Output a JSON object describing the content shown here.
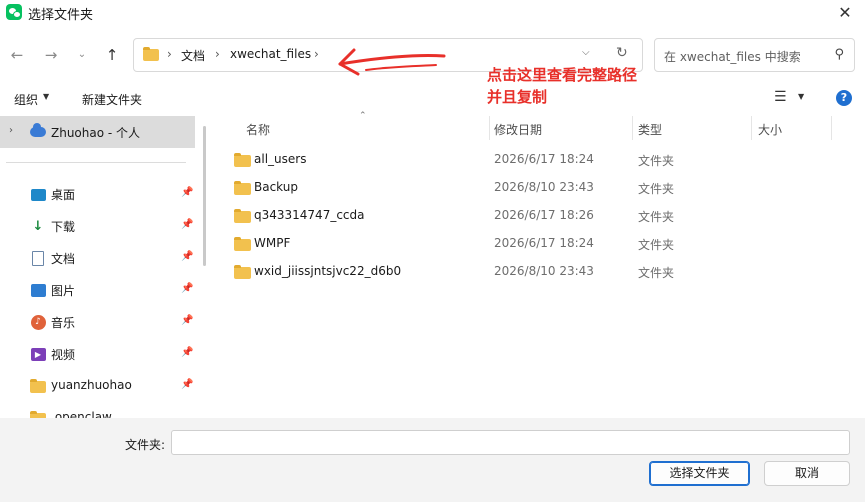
{
  "window": {
    "title": "选择文件夹",
    "close_label": "✕"
  },
  "nav": {
    "back_label": "←",
    "forward_label": "→",
    "recent_label": "⌄",
    "up_label": "↑"
  },
  "address": {
    "crumbs": [
      "文档",
      "xwechat_files"
    ],
    "separator": "›"
  },
  "search": {
    "placeholder": "在 xwechat_files 中搜索"
  },
  "annotation": {
    "text_line1": "点击这里查看完整路径",
    "text_line2": "并且复制",
    "color": "#e8302a"
  },
  "toolbar": {
    "organize_label": "组织",
    "new_folder_label": "新建文件夹",
    "help_label": "?"
  },
  "sidebar": {
    "selected_label": "Zhuohao - 个人",
    "items": [
      {
        "label": "桌面",
        "icon": "desktop-icon",
        "pinned": true
      },
      {
        "label": "下载",
        "icon": "download-icon",
        "pinned": true
      },
      {
        "label": "文档",
        "icon": "document-icon",
        "pinned": true
      },
      {
        "label": "图片",
        "icon": "pictures-icon",
        "pinned": true
      },
      {
        "label": "音乐",
        "icon": "music-icon",
        "pinned": true
      },
      {
        "label": "视频",
        "icon": "video-icon",
        "pinned": true
      },
      {
        "label": "yuanzhuohao",
        "icon": "folder-icon",
        "pinned": true
      },
      {
        "label": ".openclaw",
        "icon": "folder-icon",
        "pinned": false
      }
    ]
  },
  "columns": {
    "name": "名称",
    "modified": "修改日期",
    "type": "类型",
    "size": "大小"
  },
  "files": [
    {
      "name": "all_users",
      "modified": "2026/6/17 18:24",
      "type": "文件夹"
    },
    {
      "name": "Backup",
      "modified": "2026/8/10 23:43",
      "type": "文件夹"
    },
    {
      "name": "q343314747_ccda",
      "modified": "2026/6/17 18:26",
      "type": "文件夹"
    },
    {
      "name": "WMPF",
      "modified": "2026/6/17 18:24",
      "type": "文件夹"
    },
    {
      "name": "wxid_jiissjntsjvc22_d6b0",
      "modified": "2026/8/10 23:43",
      "type": "文件夹"
    }
  ],
  "bottom": {
    "folder_label": "文件夹:",
    "folder_value": "",
    "select_button": "选择文件夹",
    "cancel_button": "取消"
  }
}
